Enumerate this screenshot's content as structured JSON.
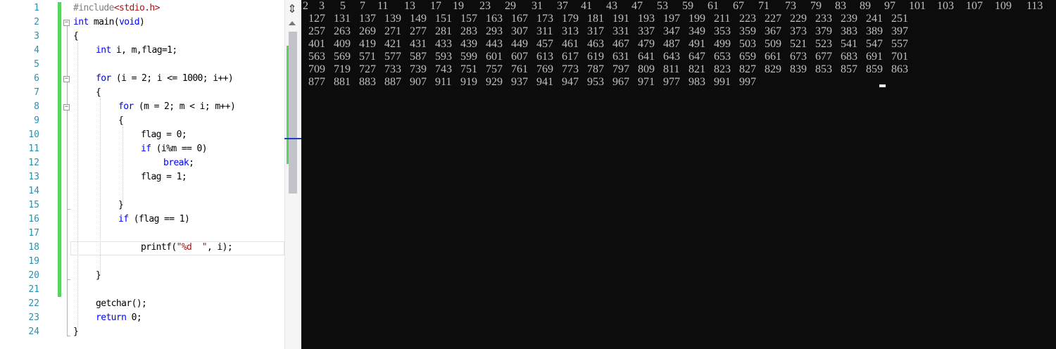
{
  "editor": {
    "line_numbers": [
      "1",
      "2",
      "3",
      "4",
      "5",
      "6",
      "7",
      "8",
      "9",
      "10",
      "11",
      "12",
      "13",
      "14",
      "15",
      "16",
      "17",
      "18",
      "19",
      "20",
      "21",
      "22",
      "23",
      "24"
    ],
    "scrollbar": {
      "split_icon": "split-window-icon"
    }
  },
  "console": {
    "lines": [
      [
        "2",
        "3",
        "5",
        "7",
        "11",
        "13",
        "17",
        "19",
        "23",
        "29",
        "31",
        "37",
        "41",
        "43",
        "47",
        "53",
        "59",
        "61",
        "67",
        "71",
        "73",
        "79",
        "83",
        "89",
        "97",
        "101",
        "103",
        "107",
        "109",
        "113"
      ],
      [
        "127",
        "131",
        "137",
        "139",
        "149",
        "151",
        "157",
        "163",
        "167",
        "173",
        "179",
        "181",
        "191",
        "193",
        "197",
        "199",
        "211",
        "223",
        "227",
        "229",
        "233",
        "239",
        "241",
        "251"
      ],
      [
        "257",
        "263",
        "269",
        "271",
        "277",
        "281",
        "283",
        "293",
        "307",
        "311",
        "313",
        "317",
        "331",
        "337",
        "347",
        "349",
        "353",
        "359",
        "367",
        "373",
        "379",
        "383",
        "389",
        "397"
      ],
      [
        "401",
        "409",
        "419",
        "421",
        "431",
        "433",
        "439",
        "443",
        "449",
        "457",
        "461",
        "463",
        "467",
        "479",
        "487",
        "491",
        "499",
        "503",
        "509",
        "521",
        "523",
        "541",
        "547",
        "557"
      ],
      [
        "563",
        "569",
        "571",
        "577",
        "587",
        "593",
        "599",
        "601",
        "607",
        "613",
        "617",
        "619",
        "631",
        "641",
        "643",
        "647",
        "653",
        "659",
        "661",
        "673",
        "677",
        "683",
        "691",
        "701"
      ],
      [
        "709",
        "719",
        "727",
        "733",
        "739",
        "743",
        "751",
        "757",
        "761",
        "769",
        "773",
        "787",
        "797",
        "809",
        "811",
        "821",
        "823",
        "827",
        "829",
        "839",
        "853",
        "857",
        "859",
        "863"
      ],
      [
        "877",
        "881",
        "883",
        "887",
        "907",
        "911",
        "919",
        "929",
        "937",
        "941",
        "947",
        "953",
        "967",
        "971",
        "977",
        "983",
        "991",
        "997"
      ]
    ]
  },
  "colors": {
    "keyword": "#0000ff",
    "preprocessor": "#808080",
    "string": "#a31515",
    "line_number": "#2b91af",
    "console_bg": "#0c0c0c",
    "console_text": "#c0c0c0",
    "change_bar": "#57d35f"
  }
}
